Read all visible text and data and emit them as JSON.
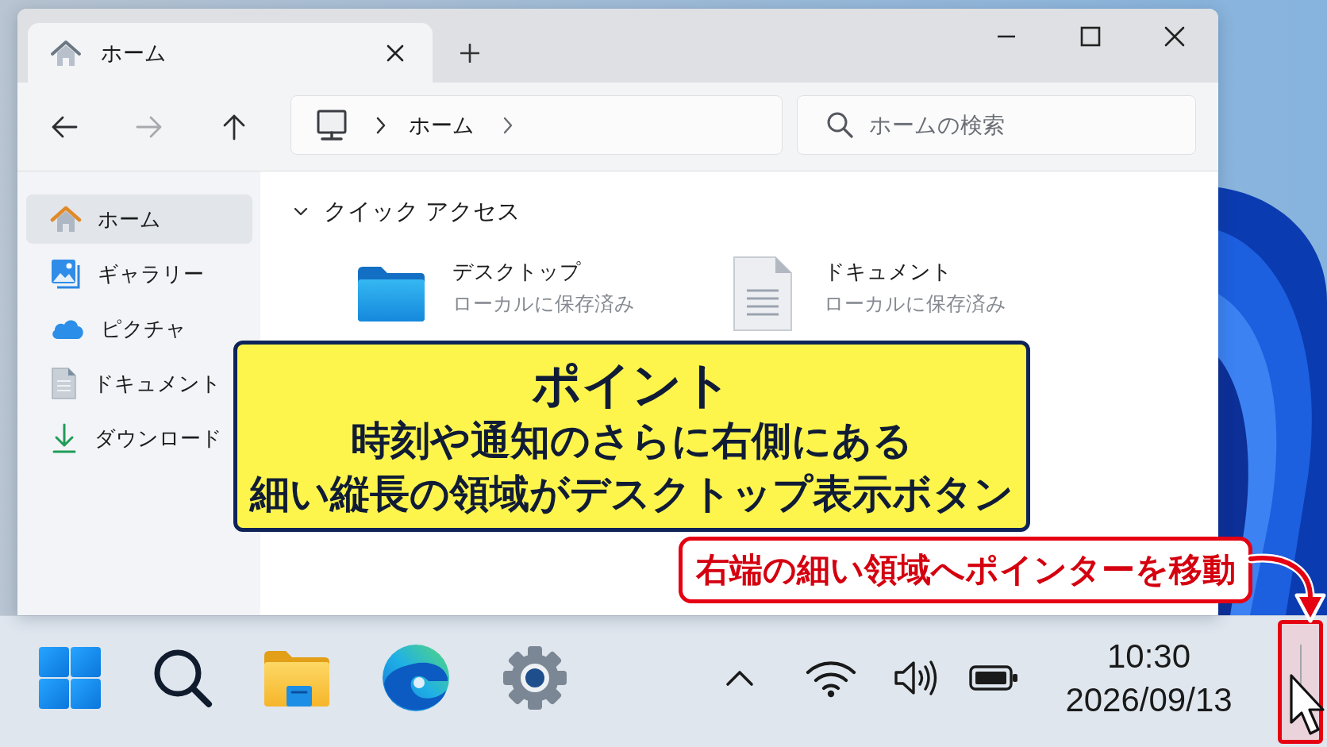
{
  "window": {
    "tabs": [
      {
        "label": "ホーム",
        "selected": true
      }
    ]
  },
  "toolbar": {
    "nav": [
      {
        "kind": "back",
        "disabled": false
      },
      {
        "kind": "forward",
        "disabled": true
      },
      {
        "kind": "up",
        "disabled": false
      }
    ],
    "address": {
      "crumbs": [
        "ホーム"
      ]
    },
    "search": {
      "placeholder": "ホームの検索"
    }
  },
  "sidebar": {
    "items": [
      {
        "kind": "home",
        "label": "ホーム",
        "selected": true
      },
      {
        "kind": "gallery",
        "label": "ギャラリー",
        "selected": false
      },
      {
        "kind": "pictures",
        "label": "ピクチャ",
        "selected": false
      },
      {
        "kind": "documents",
        "label": "ドキュメント",
        "selected": false
      },
      {
        "kind": "downloads",
        "label": "ダウンロード",
        "selected": false
      }
    ]
  },
  "quick_access": {
    "title": "クイック アクセス",
    "expanded": true,
    "items": [
      {
        "kind": "folder",
        "name": "デスクトップ",
        "status": "ローカルに保存済み"
      },
      {
        "kind": "document",
        "name": "ドキュメント",
        "status": "ローカルに保存済み"
      }
    ]
  },
  "callout": {
    "title": "ポイント",
    "lines": [
      "時刻や通知のさらに右側にある",
      "細い縦長の領域がデスクトップ表示ボタン"
    ]
  },
  "pointer_note": {
    "text": "右端の細い領域へポインターを移動"
  },
  "taskbar": {
    "apps": [
      {
        "kind": "start"
      },
      {
        "kind": "search"
      },
      {
        "kind": "explorer"
      },
      {
        "kind": "browser"
      },
      {
        "kind": "settings"
      }
    ],
    "tray": [
      {
        "kind": "overflow"
      },
      {
        "kind": "wifi"
      },
      {
        "kind": "volume"
      },
      {
        "kind": "battery"
      }
    ],
    "clock": {
      "time": "10:30",
      "date": "2026/09/13"
    },
    "show_desktop": {
      "highlighted": true
    }
  }
}
